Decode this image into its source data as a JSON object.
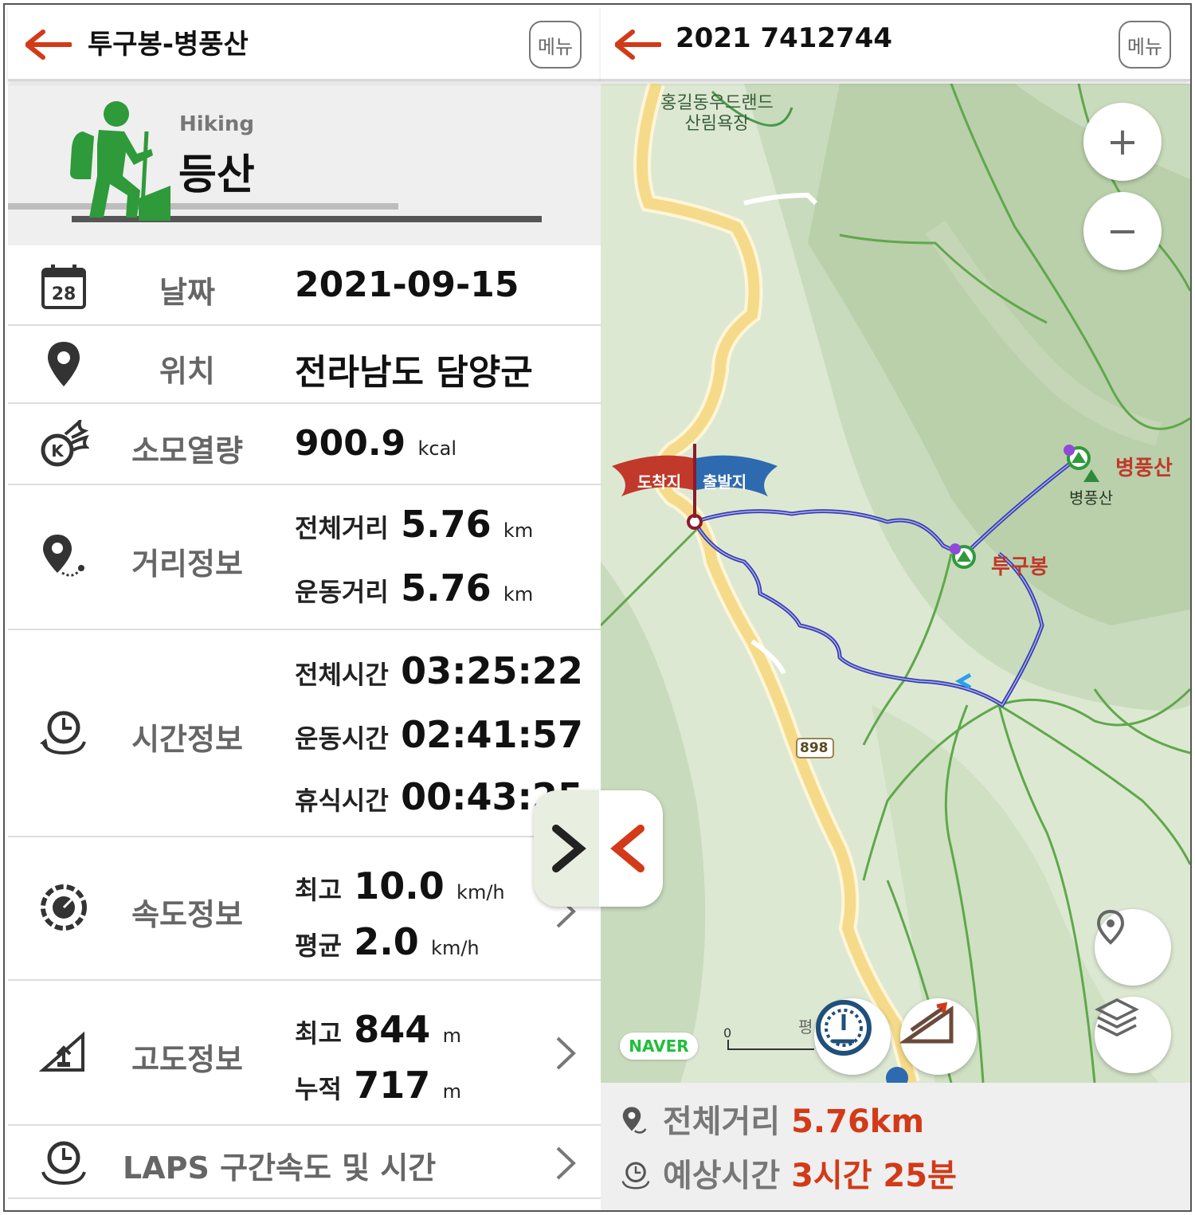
{
  "left": {
    "title": "투구봉-병풍산",
    "menu_label": "메뉴",
    "activity_en": "Hiking",
    "activity_ko": "등산",
    "date": {
      "label": "날짜",
      "value": "2021-09-15",
      "icon_day": "28"
    },
    "location": {
      "label": "위치",
      "value": "전라남도 담양군"
    },
    "calories": {
      "label": "소모열량",
      "value": "900.9",
      "unit": "kcal"
    },
    "distance": {
      "label": "거리정보",
      "total_label": "전체거리",
      "total_value": "5.76",
      "total_unit": "km",
      "move_label": "운동거리",
      "move_value": "5.76",
      "move_unit": "km"
    },
    "time": {
      "label": "시간정보",
      "total_label": "전체시간",
      "total_value": "03:25:22",
      "move_label": "운동시간",
      "move_value": "02:41:57",
      "rest_label": "휴식시간",
      "rest_value": "00:43:25"
    },
    "speed": {
      "label": "속도정보",
      "max_label": "최고",
      "max_value": "10.0",
      "max_unit": "km/h",
      "avg_label": "평균",
      "avg_value": "2.0",
      "avg_unit": "km/h"
    },
    "altitude": {
      "label": "고도정보",
      "max_label": "최고",
      "max_value": "844",
      "max_unit": "m",
      "cum_label": "누적",
      "cum_value": "717",
      "cum_unit": "m"
    },
    "laps_label": "LAPS 구간속도 및 시간"
  },
  "right": {
    "title": "2021 7412744",
    "menu_label": "메뉴",
    "map": {
      "place_recreation": "홍길동우드랜드\n산림욕장",
      "arrival_flag": "도착지",
      "departure_flag": "출발지",
      "peak1_red": "병풍산",
      "peak1_small": "병풍산",
      "peak2_red": "투구봉",
      "road_number": "898",
      "naver_logo": "NAVER",
      "scale_zero": "0",
      "partial_text": "평"
    },
    "zoom_in": "+",
    "zoom_out": "−",
    "summary": {
      "distance_label": "전체거리",
      "distance_value": "5.76km",
      "time_label": "예상시간",
      "time_value": "3시간 25분"
    }
  },
  "colors": {
    "accent_red": "#d23a18",
    "hiker_green": "#2e9a3a",
    "route_blue": "#3a3fb0"
  }
}
